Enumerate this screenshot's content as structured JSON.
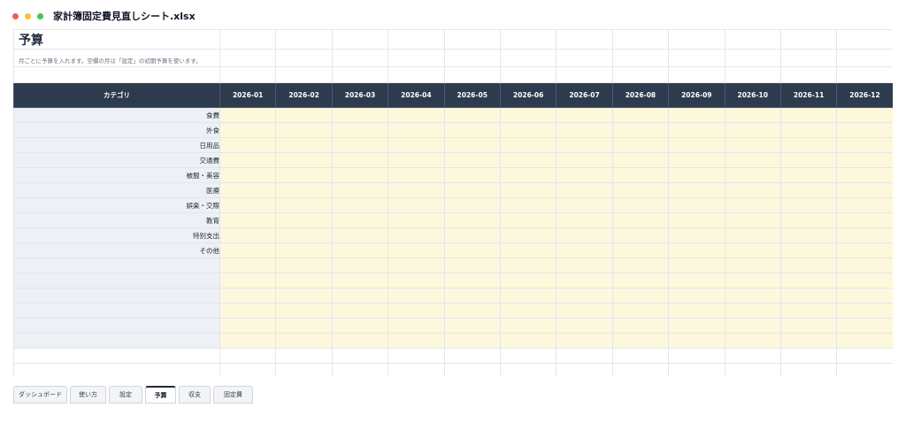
{
  "window": {
    "title": "家計簿固定費見直しシート.xlsx"
  },
  "sheet": {
    "title": "予算",
    "note": "月ごとに予算を入れます。空欄の月は「設定」の初期予算を使います。",
    "category_header": "カテゴリ",
    "months": [
      "2026-01",
      "2026-02",
      "2026-03",
      "2026-04",
      "2026-05",
      "2026-06",
      "2026-07",
      "2026-08",
      "2026-09",
      "2026-10",
      "2026-11",
      "2026-12"
    ],
    "categories": [
      "食費",
      "外食",
      "日用品",
      "交通費",
      "被服・美容",
      "医療",
      "娯楽・交際",
      "教育",
      "特別支出",
      "その他",
      "",
      "",
      "",
      "",
      "",
      ""
    ]
  },
  "tabs": [
    {
      "label": "ダッシュボード",
      "active": false
    },
    {
      "label": "使い方",
      "active": false
    },
    {
      "label": "設定",
      "active": false
    },
    {
      "label": "予算",
      "active": true
    },
    {
      "label": "収支",
      "active": false
    },
    {
      "label": "固定費",
      "active": false
    }
  ]
}
